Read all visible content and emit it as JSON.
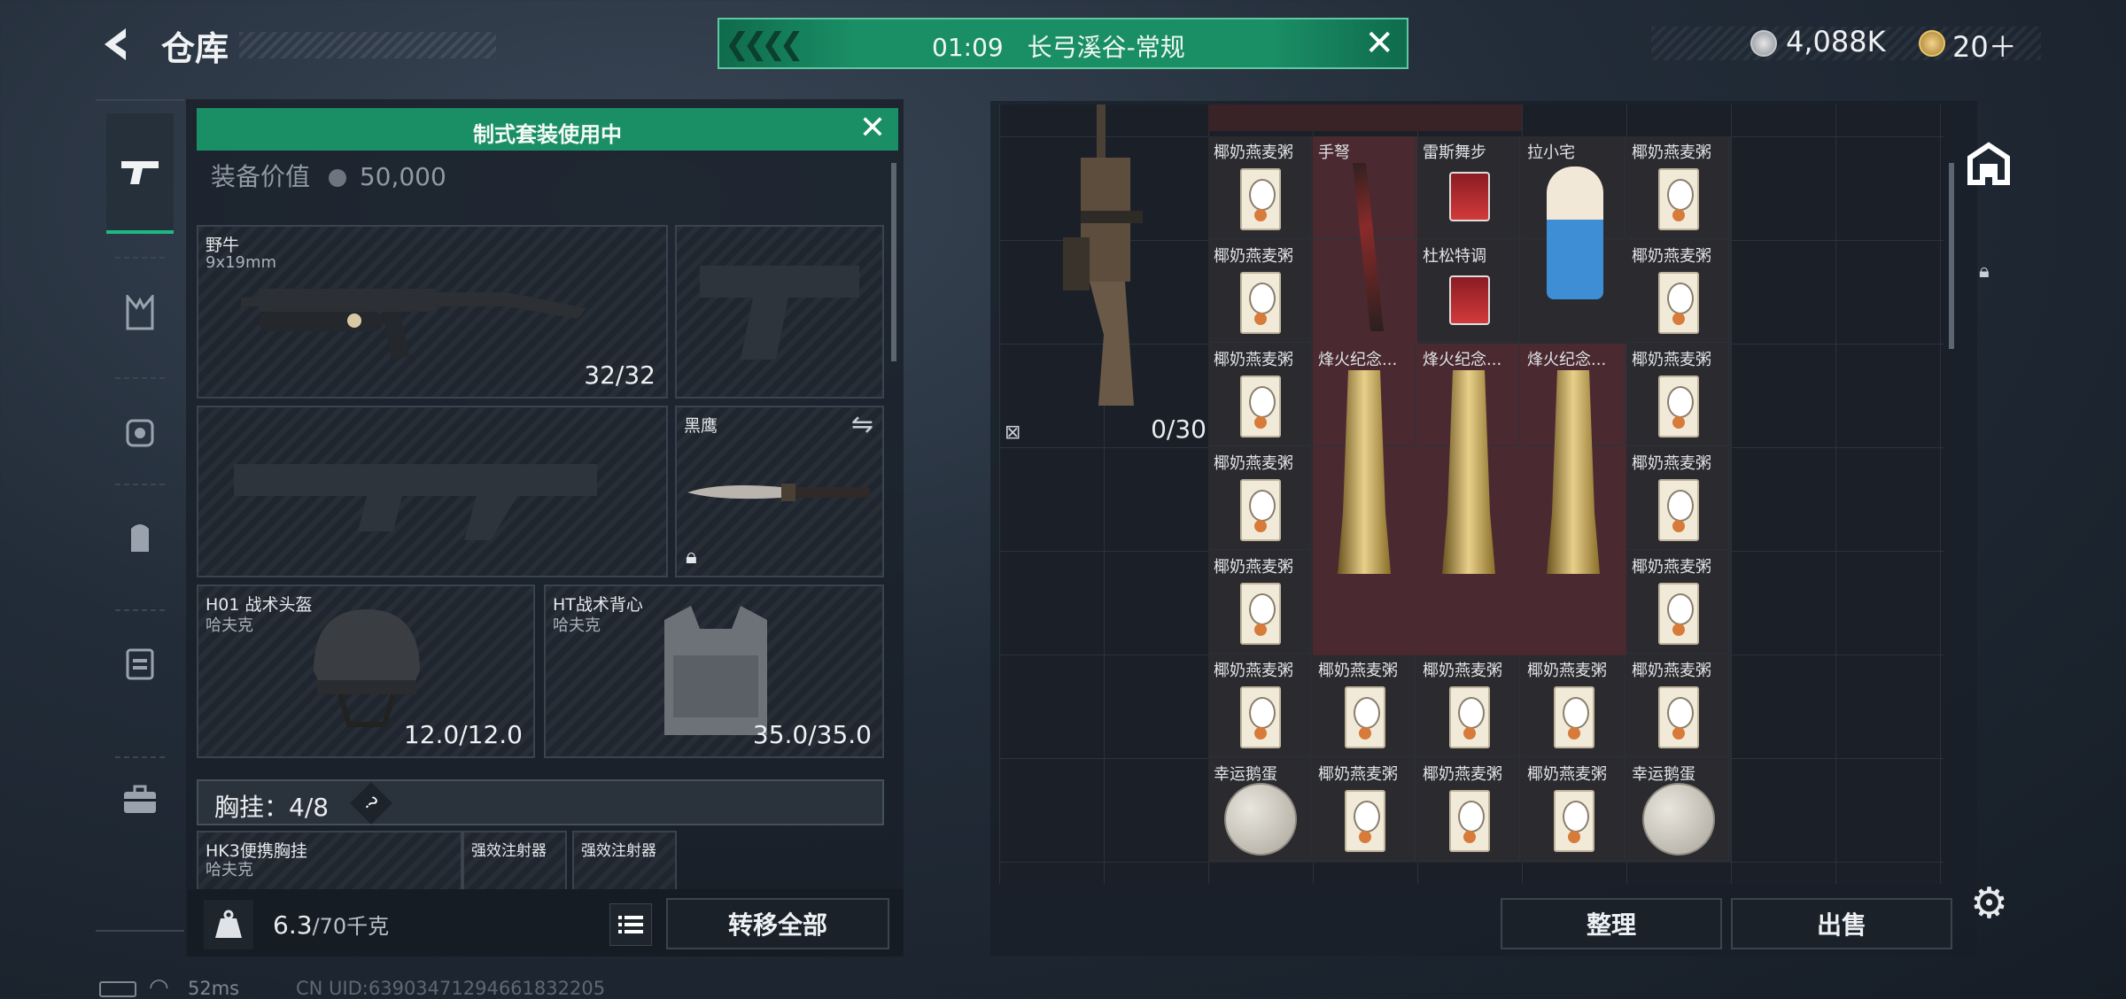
{
  "header": {
    "title": "仓库",
    "match_timer": "01:09",
    "match_map": "长弓溪谷-常规",
    "currency_amount": "4,088K",
    "ticket_amount": "20＋"
  },
  "loadout": {
    "banner": "制式套装使用中",
    "value_label": "装备价值",
    "value_amount": "50,000",
    "primary": {
      "name": "野牛",
      "ammo": "9x19mm",
      "count": "32/32"
    },
    "melee": {
      "name": "黑鹰"
    },
    "helmet": {
      "name": "H01 战术头盔",
      "brand": "哈夫克",
      "durability": "12.0/12.0"
    },
    "armor": {
      "name": "HT战术背心",
      "brand": "哈夫克",
      "durability": "35.0/35.0"
    },
    "chest_rig": {
      "label": "胸挂：4/8",
      "help": "?",
      "name": "HK3便携胸挂",
      "brand": "哈夫克",
      "slot1": "强效注射器",
      "slot2": "强效注射器"
    },
    "weight": {
      "value": "6.3",
      "max": "/70千克"
    },
    "transfer_all": "转移全部"
  },
  "stash": {
    "weapon_count": "0/30",
    "items": {
      "porridge": "椰奶燕麦粥",
      "crossbow": "手弩",
      "drink1": "雷斯舞步",
      "drink2": "杜松特调",
      "toy": "拉小宅",
      "trophy": "烽火纪念...",
      "egg": "幸运鹅蛋"
    },
    "sort_button": "整理",
    "sell_button": "出售"
  },
  "status": {
    "ping": "52ms",
    "uid": "CN UID:63903471294661832205"
  },
  "colors": {
    "accent_green": "#1a8f66",
    "dark_bg": "#161d26",
    "highlight_red": "#5a2a30"
  }
}
